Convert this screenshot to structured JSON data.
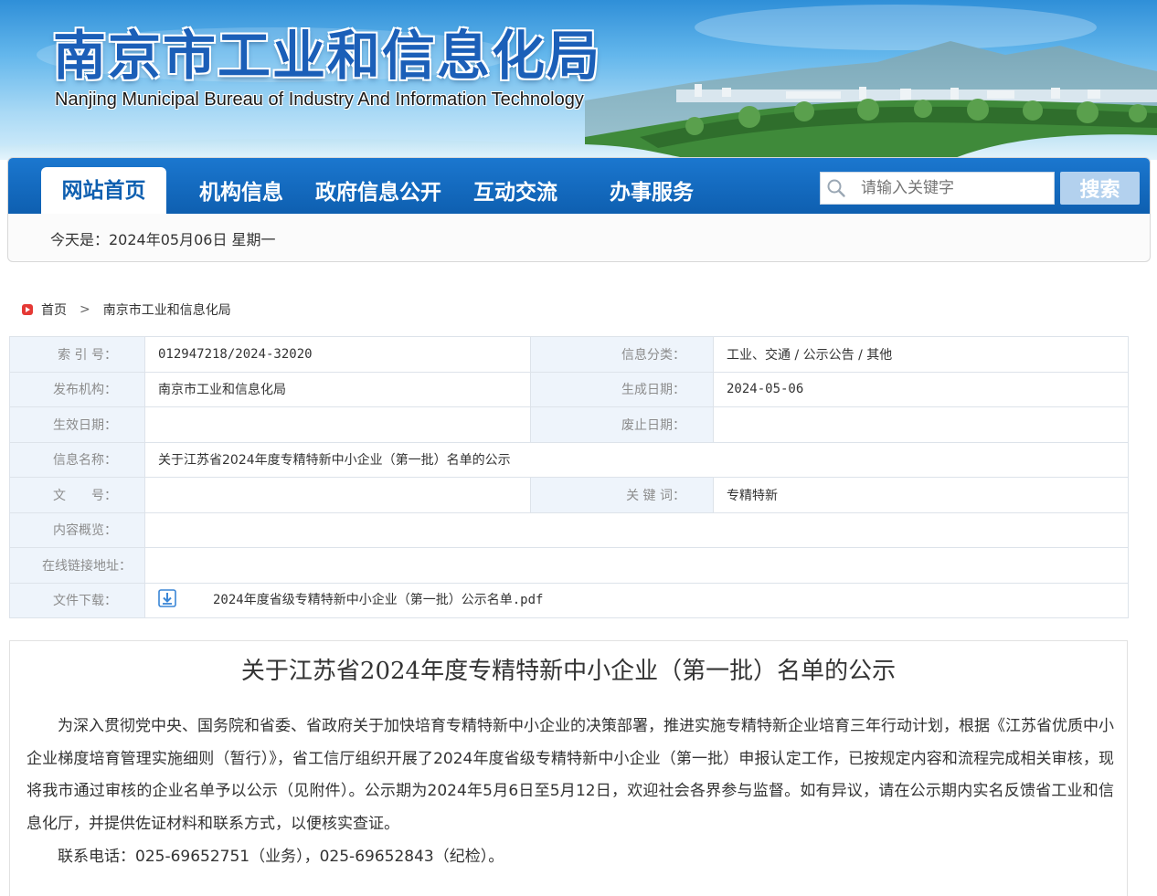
{
  "banner": {
    "title": "南京市工业和信息化局",
    "subtitle": "Nanjing Municipal Bureau of Industry And Information Technology"
  },
  "nav": {
    "items": [
      {
        "label": "网站首页"
      },
      {
        "label": "机构信息"
      },
      {
        "label": "政府信息公开"
      },
      {
        "label": "互动交流"
      },
      {
        "label": "办事服务"
      }
    ],
    "search_placeholder": "请输入关键字",
    "search_button": "搜索",
    "date_text": "今天是：2024年05月06日 星期一"
  },
  "breadcrumb": {
    "home": "首页",
    "separator": ">",
    "current": "南京市工业和信息化局"
  },
  "meta": {
    "index_label": "索 引 号：",
    "index_value": "012947218/2024-32020",
    "category_label": "信息分类：",
    "category_value": "工业、交通 / 公示公告 / 其他",
    "org_label": "发布机构：",
    "org_value": "南京市工业和信息化局",
    "gen_date_label": "生成日期：",
    "gen_date_value": "2024-05-06",
    "effective_label": "生效日期：",
    "effective_value": "",
    "abolish_label": "废止日期：",
    "abolish_value": "",
    "name_label": "信息名称：",
    "name_value": "关于江苏省2024年度专精特新中小企业（第一批）名单的公示",
    "doc_no_label": "文　　号：",
    "doc_no_value": "",
    "keywords_label": "关 键 词：",
    "keywords_value": "专精特新",
    "summary_label": "内容概览：",
    "summary_value": "",
    "link_label": "在线链接地址：",
    "link_value": "",
    "download_label": "文件下载：",
    "download_file": "2024年度省级专精特新中小企业（第一批）公示名单.pdf"
  },
  "article": {
    "title": "关于江苏省2024年度专精特新中小企业（第一批）名单的公示",
    "body": "为深入贯彻党中央、国务院和省委、省政府关于加快培育专精特新中小企业的决策部署，推进实施专精特新企业培育三年行动计划，根据《江苏省优质中小企业梯度培育管理实施细则（暂行）》，省工信厅组织开展了2024年度省级专精特新中小企业（第一批）申报认定工作，已按规定内容和流程完成相关审核，现将我市通过审核的企业名单予以公示（见附件）。公示期为2024年5月6日至5月12日，欢迎社会各界参与监督。如有异议，请在公示期内实名反馈省工业和信息化厅，并提供佐证材料和联系方式，以便核实查证。",
    "contact": "联系电话：025-69652751（业务），025-69652843（纪检）。"
  },
  "colors": {
    "nav_blue": "#0e5fb0",
    "label_bg": "#eef4fb",
    "search_button_bg": "#b3d1ee"
  }
}
